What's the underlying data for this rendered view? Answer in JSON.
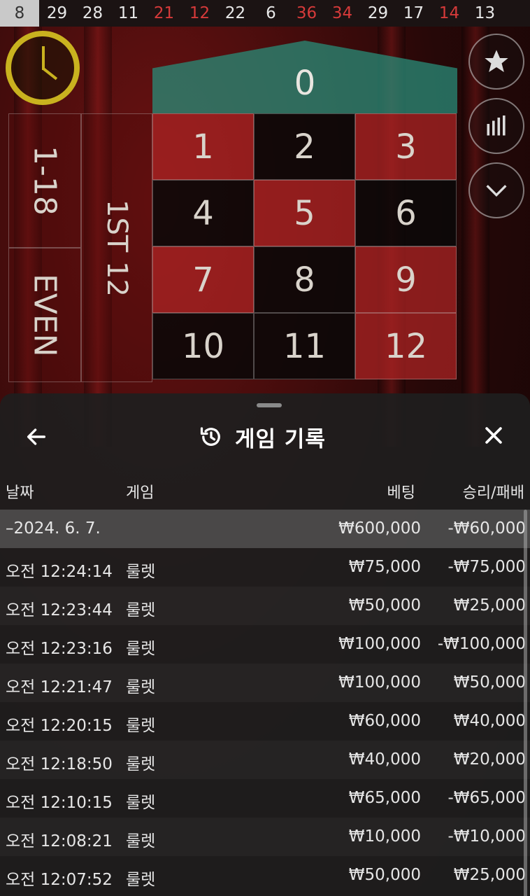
{
  "history": [
    {
      "n": "8",
      "color": "black"
    },
    {
      "n": "29",
      "color": "black"
    },
    {
      "n": "28",
      "color": "black"
    },
    {
      "n": "11",
      "color": "black"
    },
    {
      "n": "21",
      "color": "red"
    },
    {
      "n": "12",
      "color": "red"
    },
    {
      "n": "22",
      "color": "black"
    },
    {
      "n": "6",
      "color": "black"
    },
    {
      "n": "36",
      "color": "red"
    },
    {
      "n": "34",
      "color": "red"
    },
    {
      "n": "29",
      "color": "black"
    },
    {
      "n": "17",
      "color": "black"
    },
    {
      "n": "14",
      "color": "red"
    },
    {
      "n": "13",
      "color": "black"
    }
  ],
  "board": {
    "zero": "0",
    "numbers": [
      {
        "n": "1",
        "color": "red"
      },
      {
        "n": "2",
        "color": "black"
      },
      {
        "n": "3",
        "color": "red"
      },
      {
        "n": "4",
        "color": "black"
      },
      {
        "n": "5",
        "color": "red"
      },
      {
        "n": "6",
        "color": "black"
      },
      {
        "n": "7",
        "color": "red"
      },
      {
        "n": "8",
        "color": "black"
      },
      {
        "n": "9",
        "color": "red"
      },
      {
        "n": "10",
        "color": "black"
      },
      {
        "n": "11",
        "color": "black"
      },
      {
        "n": "12",
        "color": "red"
      }
    ],
    "outside_1_18": "1-18",
    "outside_even": "EVEN",
    "dozen_first": "1ST 12"
  },
  "sheet": {
    "title": "게임 기록",
    "columns": {
      "date": "날짜",
      "game": "게임",
      "bet": "베팅",
      "result": "승리/패배"
    },
    "date_row": {
      "label": "–2024. 6. 7.",
      "bet": "₩600,000",
      "result": "-₩60,000"
    },
    "rows": [
      {
        "time": "오전 12:24:14",
        "game": "룰렛",
        "bet": "₩75,000",
        "result": "-₩75,000"
      },
      {
        "time": "오전 12:23:44",
        "game": "룰렛",
        "bet": "₩50,000",
        "result": "₩25,000"
      },
      {
        "time": "오전 12:23:16",
        "game": "룰렛",
        "bet": "₩100,000",
        "result": "-₩100,000"
      },
      {
        "time": "오전 12:21:47",
        "game": "룰렛",
        "bet": "₩100,000",
        "result": "₩50,000"
      },
      {
        "time": "오전 12:20:15",
        "game": "룰렛",
        "bet": "₩60,000",
        "result": "₩40,000"
      },
      {
        "time": "오전 12:18:50",
        "game": "룰렛",
        "bet": "₩40,000",
        "result": "₩20,000"
      },
      {
        "time": "오전 12:10:15",
        "game": "룰렛",
        "bet": "₩65,000",
        "result": "-₩65,000"
      },
      {
        "time": "오전 12:08:21",
        "game": "룰렛",
        "bet": "₩10,000",
        "result": "-₩10,000"
      },
      {
        "time": "오전 12:07:52",
        "game": "룰렛",
        "bet": "₩50,000",
        "result": "₩25,000"
      }
    ]
  },
  "icons": {
    "timer": "clock-icon",
    "favorite": "star-icon",
    "stats": "bar-chart-icon",
    "collapse": "chevron-down-icon",
    "back": "arrow-left-icon",
    "history": "history-icon",
    "close": "close-icon"
  },
  "colors": {
    "red": "#d63a3a",
    "zero_green": "#289c84",
    "timer_gold": "#c9b21f"
  }
}
